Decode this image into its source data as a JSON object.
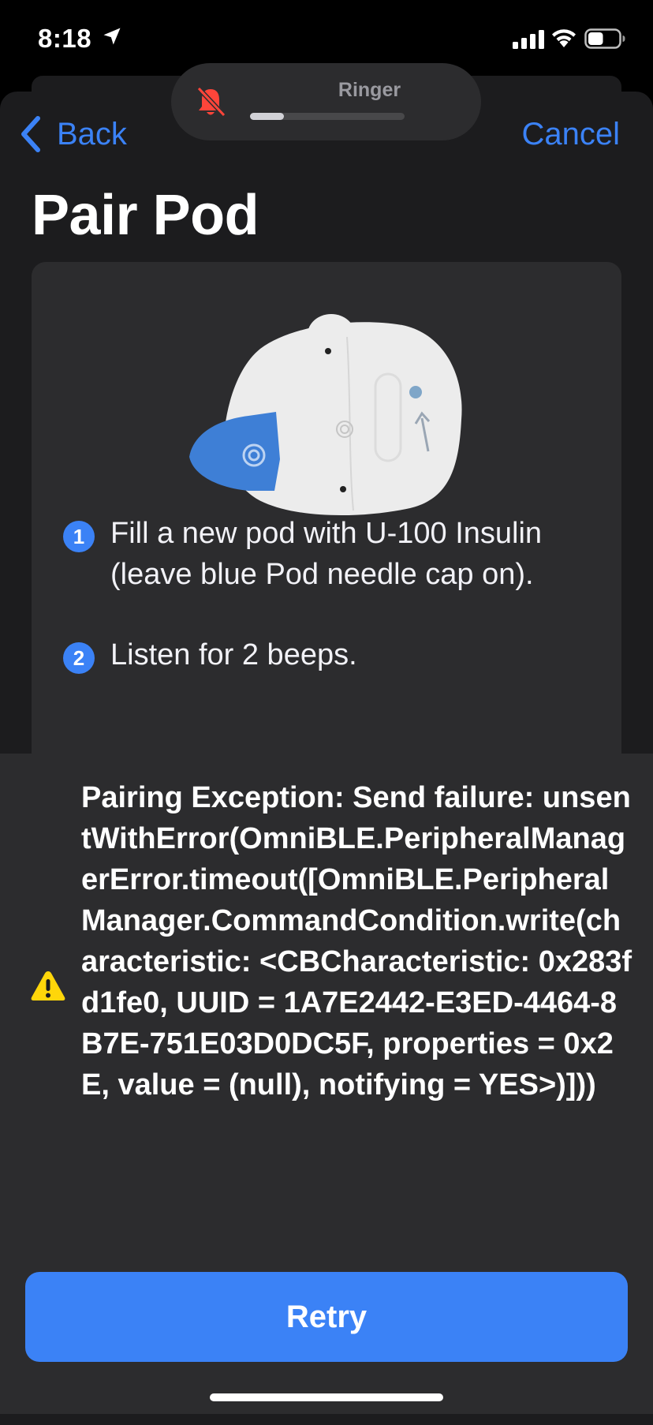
{
  "status_bar": {
    "time": "8:18",
    "battery_level": 0.5
  },
  "ringer": {
    "label": "Ringer",
    "level": 0.22,
    "muted_color": "#ff453a"
  },
  "nav": {
    "back_label": "Back",
    "cancel_label": "Cancel",
    "accent_color": "#3b82f6"
  },
  "title": "Pair Pod",
  "steps": [
    {
      "number": "1",
      "text": "Fill a new pod with U-100 Insulin (leave blue Pod needle cap on)."
    },
    {
      "number": "2",
      "text": "Listen for 2 beeps."
    }
  ],
  "error": {
    "icon": "warning-icon",
    "icon_color": "#ffd60a",
    "message": "Pairing Exception: Send failure: unsentWithError(OmniBLE.PeripheralManagerError.timeout([OmniBLE.PeripheralManager.CommandCondition.write(characteristic: <CBCharacteristic: 0x283fd1fe0, UUID = 1A7E2442-E3ED-4464-8B7E-751E03D0DC5F, properties = 0x2E, value = (null), notifying = YES>)]))"
  },
  "retry_label": "Retry"
}
